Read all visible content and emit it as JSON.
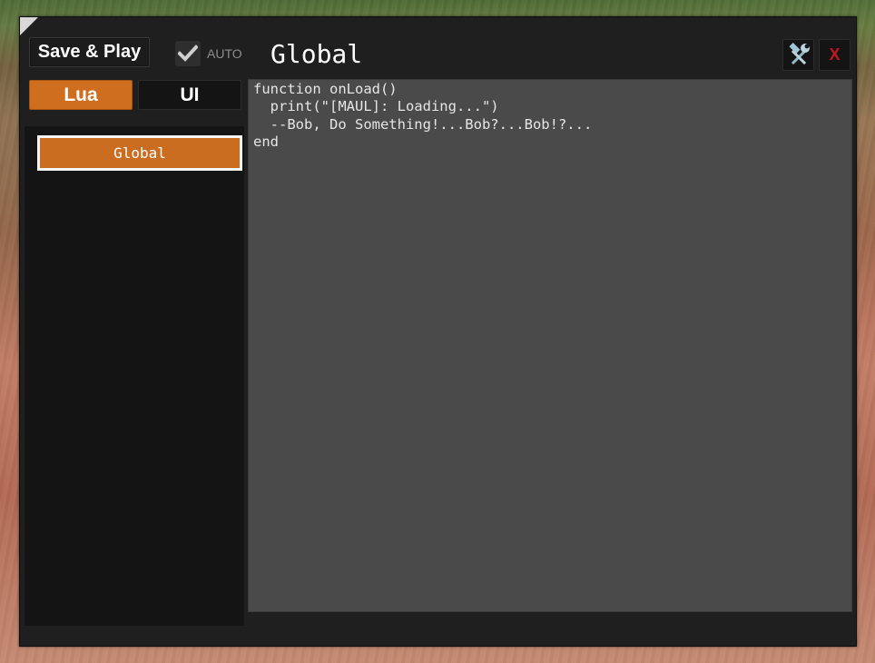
{
  "toolbar": {
    "save_play_label": "Save & Play",
    "auto_label": "AUTO",
    "auto_checked": true
  },
  "editor_title": "Global",
  "tabs": [
    {
      "label": "Lua",
      "active": true
    },
    {
      "label": "UI",
      "active": false
    }
  ],
  "scripts": [
    {
      "label": "Global",
      "selected": true
    }
  ],
  "code": {
    "lines": [
      "function onLoad()",
      "  print(\"[MAUL]: Loading...\")",
      "  --Bob, Do Something!...Bob?...Bob!?...",
      "end"
    ]
  },
  "window_controls": {
    "close_label": "X"
  },
  "icons": {
    "tools": "tools-icon",
    "checkmark": "checkmark-icon"
  },
  "colors": {
    "accent": "#cf6e1f",
    "close": "#c0191d",
    "editor_bg": "#4a4a4a",
    "panel_bg": "#1f1f1f"
  }
}
